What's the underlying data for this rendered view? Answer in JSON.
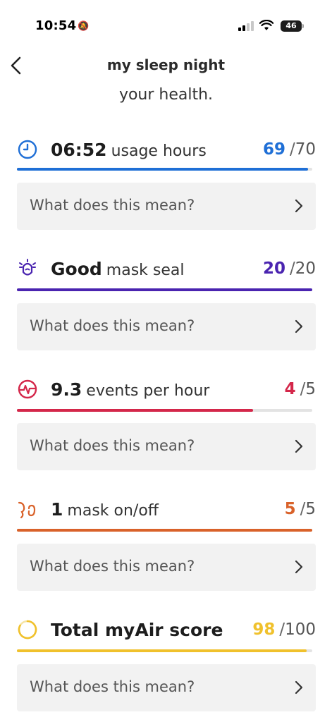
{
  "status": {
    "time": "10:54",
    "battery": "46"
  },
  "header": {
    "title": "my sleep night",
    "subtitle": "your health."
  },
  "colors": {
    "usage": "#1f6fd6",
    "seal": "#4a24b0",
    "events": "#d4274a",
    "mask": "#d9622a",
    "total": "#f0c12c"
  },
  "metrics": [
    {
      "icon": "clock-icon",
      "value": "06:52",
      "desc": "usage hours",
      "score": "69",
      "max": "70",
      "fraction": 0.9857
    },
    {
      "icon": "mask-seal-icon",
      "value": "Good",
      "desc": "mask seal",
      "score": "20",
      "max": "20",
      "fraction": 1.0
    },
    {
      "icon": "heartbeat-icon",
      "value": "9.3",
      "desc": "events per hour",
      "score": "4",
      "max": "5",
      "fraction": 0.8
    },
    {
      "icon": "mask-on-off-icon",
      "value": "1",
      "desc": "mask on/off",
      "score": "5",
      "max": "5",
      "fraction": 1.0
    },
    {
      "icon": "score-ring-icon",
      "value": "Total myAir score",
      "desc": "",
      "score": "98",
      "max": "100",
      "fraction": 0.98
    }
  ],
  "info_label": "What does this mean?"
}
